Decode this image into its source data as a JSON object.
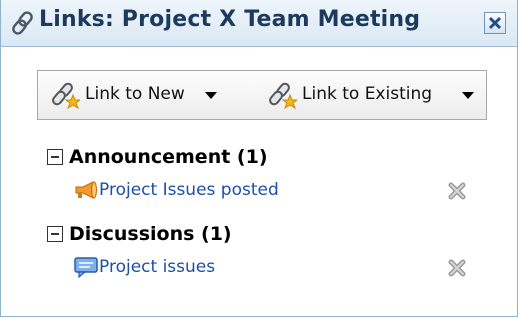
{
  "panel": {
    "title": "Links: Project X Team Meeting",
    "close_icon": "close-icon"
  },
  "toolbar": {
    "link_new_label": "Link to New",
    "link_existing_label": "Link to Existing"
  },
  "sections": [
    {
      "heading": "Announcement (1)",
      "items": [
        {
          "label": "Project Issues posted",
          "icon": "megaphone-icon"
        }
      ]
    },
    {
      "heading": "Discussions (1)",
      "items": [
        {
          "label": "Project issues",
          "icon": "discussion-icon"
        }
      ]
    }
  ]
}
